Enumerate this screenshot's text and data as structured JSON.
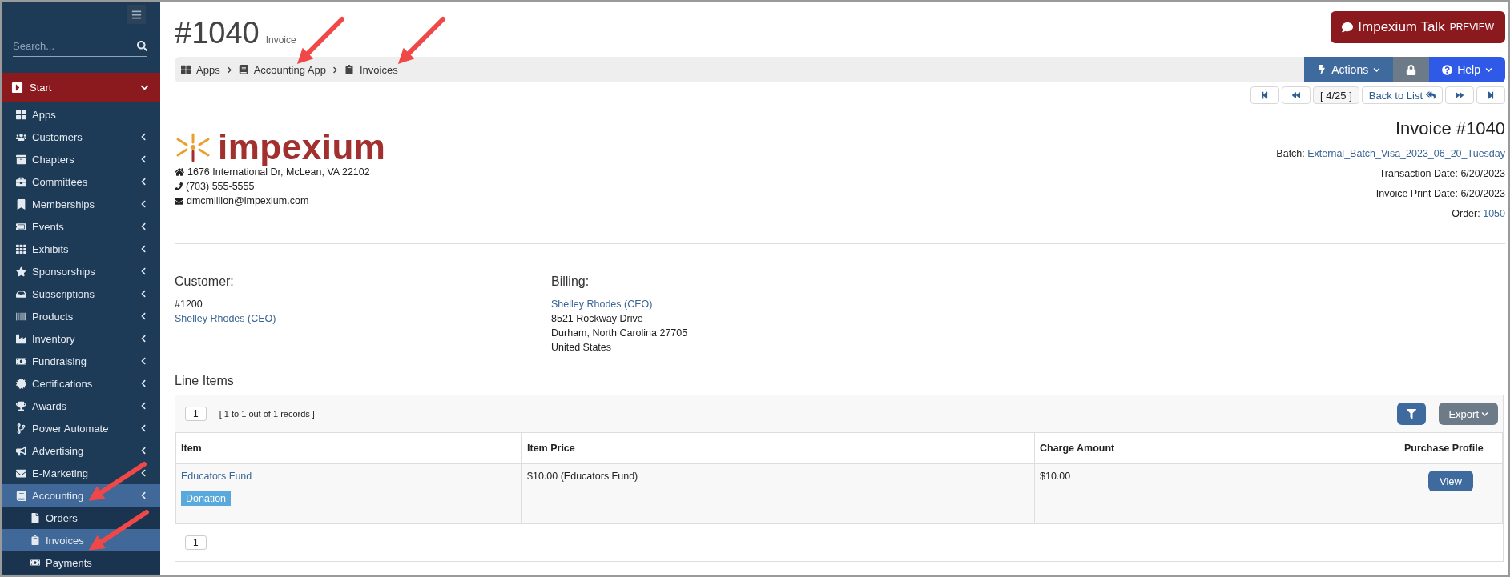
{
  "sidebar": {
    "search": {
      "placeholder": "Search..."
    },
    "start": {
      "label": "Start",
      "expanded": true
    },
    "items": [
      {
        "label": "Apps",
        "expandable": false,
        "selected": false
      },
      {
        "label": "Customers",
        "expandable": true,
        "selected": false
      },
      {
        "label": "Chapters",
        "expandable": true,
        "selected": false
      },
      {
        "label": "Committees",
        "expandable": true,
        "selected": false
      },
      {
        "label": "Memberships",
        "expandable": true,
        "selected": false
      },
      {
        "label": "Events",
        "expandable": true,
        "selected": false
      },
      {
        "label": "Exhibits",
        "expandable": true,
        "selected": false
      },
      {
        "label": "Sponsorships",
        "expandable": true,
        "selected": false
      },
      {
        "label": "Subscriptions",
        "expandable": true,
        "selected": false
      },
      {
        "label": "Products",
        "expandable": true,
        "selected": false
      },
      {
        "label": "Inventory",
        "expandable": true,
        "selected": false
      },
      {
        "label": "Fundraising",
        "expandable": true,
        "selected": false
      },
      {
        "label": "Certifications",
        "expandable": true,
        "selected": false
      },
      {
        "label": "Awards",
        "expandable": true,
        "selected": false
      },
      {
        "label": "Power Automate",
        "expandable": true,
        "selected": false
      },
      {
        "label": "Advertising",
        "expandable": true,
        "selected": false
      },
      {
        "label": "E-Marketing",
        "expandable": true,
        "selected": false
      },
      {
        "label": "Accounting",
        "expandable": true,
        "selected": true,
        "children": [
          {
            "label": "Orders",
            "selected": false
          },
          {
            "label": "Invoices",
            "selected": true
          },
          {
            "label": "Payments",
            "selected": false
          }
        ]
      }
    ]
  },
  "header": {
    "title": "#1040",
    "subtitle": "Invoice",
    "talk_button": {
      "label": "Impexium Talk",
      "badge": "PREVIEW"
    }
  },
  "breadcrumb": [
    "Apps",
    "Accounting App",
    "Invoices"
  ],
  "toolbar": {
    "actions": "Actions",
    "help": "Help"
  },
  "pager": {
    "position": "[ 4/25 ]",
    "back": "Back to List"
  },
  "company": {
    "logo_text": "impexium",
    "address": "1676 International Dr, McLean, VA 22102",
    "phone": "(703) 555-5555",
    "email": "dmcmillion@impexium.com"
  },
  "invoice": {
    "title": "Invoice #1040",
    "fields": [
      {
        "label": "Batch:",
        "value": "External_Batch_Visa_2023_06_20_Tuesday",
        "link": true
      },
      {
        "label": "Transaction Date:",
        "value": "6/20/2023",
        "link": false
      },
      {
        "label": "Invoice Print Date:",
        "value": "6/20/2023",
        "link": false
      },
      {
        "label": "Order:",
        "value": "1050",
        "link": true
      }
    ]
  },
  "customer": {
    "heading": "Customer:",
    "number": "#1200",
    "name": "Shelley Rhodes (CEO)"
  },
  "billing": {
    "heading": "Billing:",
    "name": "Shelley Rhodes (CEO)",
    "lines": [
      "8521 Rockway Drive",
      "Durham, North Carolina 27705",
      "United States"
    ]
  },
  "line_items": {
    "heading": "Line Items",
    "page": "1",
    "records": "[ 1 to 1 out of 1 records ]",
    "export": "Export",
    "columns": [
      "Item",
      "Item Price",
      "Charge Amount",
      "Purchase Profile"
    ],
    "rows": [
      {
        "item": "Educators Fund",
        "tag": "Donation",
        "price": "$10.00 (Educators Fund)",
        "charge": "$10.00",
        "action": "View"
      }
    ],
    "footer_page": "1"
  }
}
